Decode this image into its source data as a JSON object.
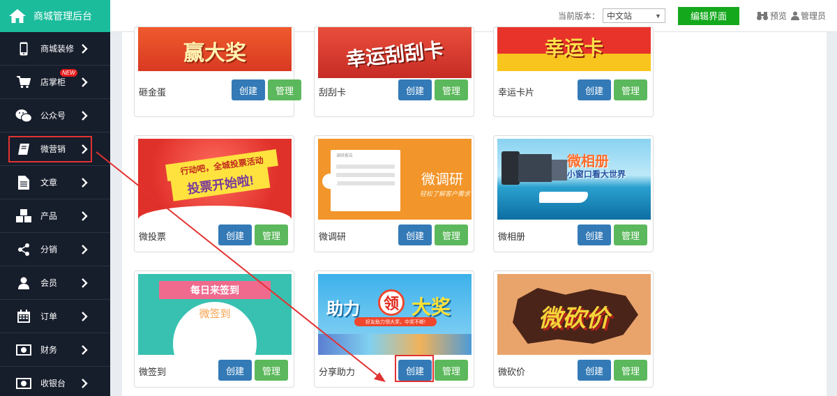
{
  "brand": {
    "title": "商城管理后台"
  },
  "topbar": {
    "version_label": "当前版本：",
    "version_value": "中文站",
    "edit_button": "编辑界面",
    "preview": "预览",
    "admin": "管理员"
  },
  "sidebar": {
    "items": [
      {
        "label": "商城装修",
        "icon": "mobile-icon"
      },
      {
        "label": "店掌柜",
        "icon": "cart-icon",
        "badge": "NEW"
      },
      {
        "label": "公众号",
        "icon": "wechat-icon"
      },
      {
        "label": "微营销",
        "icon": "book-icon",
        "active": true
      },
      {
        "label": "文章",
        "icon": "document-icon"
      },
      {
        "label": "产品",
        "icon": "cubes-icon"
      },
      {
        "label": "分销",
        "icon": "share-icon"
      },
      {
        "label": "会员",
        "icon": "user-icon"
      },
      {
        "label": "订单",
        "icon": "calendar-icon"
      },
      {
        "label": "财务",
        "icon": "money-icon"
      },
      {
        "label": "收银台",
        "icon": "cashier-icon"
      }
    ]
  },
  "cards": [
    {
      "name": "砸金蛋",
      "banner_text": "赢大奖"
    },
    {
      "name": "刮刮卡",
      "banner_text": "幸运刮刮卡"
    },
    {
      "name": "幸运卡片",
      "banner_text": "幸运卡"
    },
    {
      "name": "微投票",
      "banner_line1": "行动吧，全城投票活动",
      "banner_line2": "投票开始啦!"
    },
    {
      "name": "微调研",
      "banner_title": "微调研",
      "banner_sub": "轻松了解客户需求",
      "doc_title": "调研报告"
    },
    {
      "name": "微相册",
      "banner_title": "微相册",
      "banner_sub": "小窗口看大世界"
    },
    {
      "name": "微签到",
      "banner_ribbon": "每日来签到",
      "banner_sub": "微签到"
    },
    {
      "name": "分享助力",
      "banner_title_a": "助力",
      "banner_title_b": "领",
      "banner_title_c": "大奖",
      "banner_sub": "好友助力领大奖，中奖不断!"
    },
    {
      "name": "微砍价",
      "banner_title": "微砍价"
    }
  ],
  "buttons": {
    "create": "创建",
    "manage": "管理"
  },
  "colors": {
    "brand": "#1abc9c",
    "sidebar": "#161d2b",
    "edit": "#14a81d",
    "create": "#337ab7",
    "manage": "#5cb85c",
    "highlight": "#e23232"
  }
}
